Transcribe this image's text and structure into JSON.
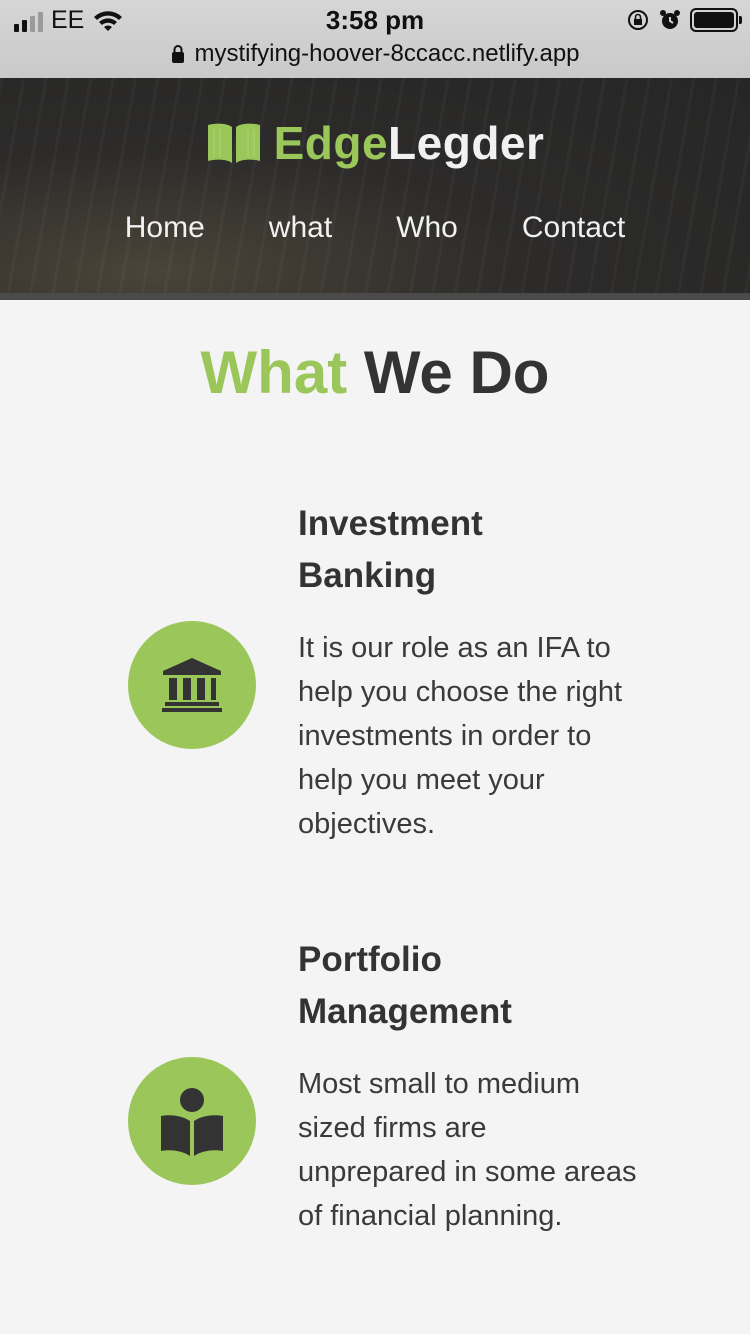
{
  "status": {
    "carrier": "EE",
    "time": "3:58 pm",
    "url": "mystifying-hoover-8ccacc.netlify.app"
  },
  "brand": {
    "part1": "Edge",
    "part2": "Legder",
    "icon": "book-open-icon"
  },
  "nav": {
    "items": [
      "Home",
      "what",
      "Who",
      "Contact"
    ]
  },
  "section": {
    "title_accent": "What",
    "title_rest": "We Do"
  },
  "services": [
    {
      "title": "Investment Banking",
      "icon": "bank-icon",
      "description": "It is our role as an IFA to help you choose the right investments in order to help you meet your objectives."
    },
    {
      "title": "Portfolio Management",
      "icon": "book-reader-icon",
      "description": "Most small to medium sized firms are unprepared in some areas of financial planning."
    }
  ],
  "colors": {
    "accent": "#9bc65a",
    "dark": "#333333",
    "background": "#f4f4f4"
  }
}
